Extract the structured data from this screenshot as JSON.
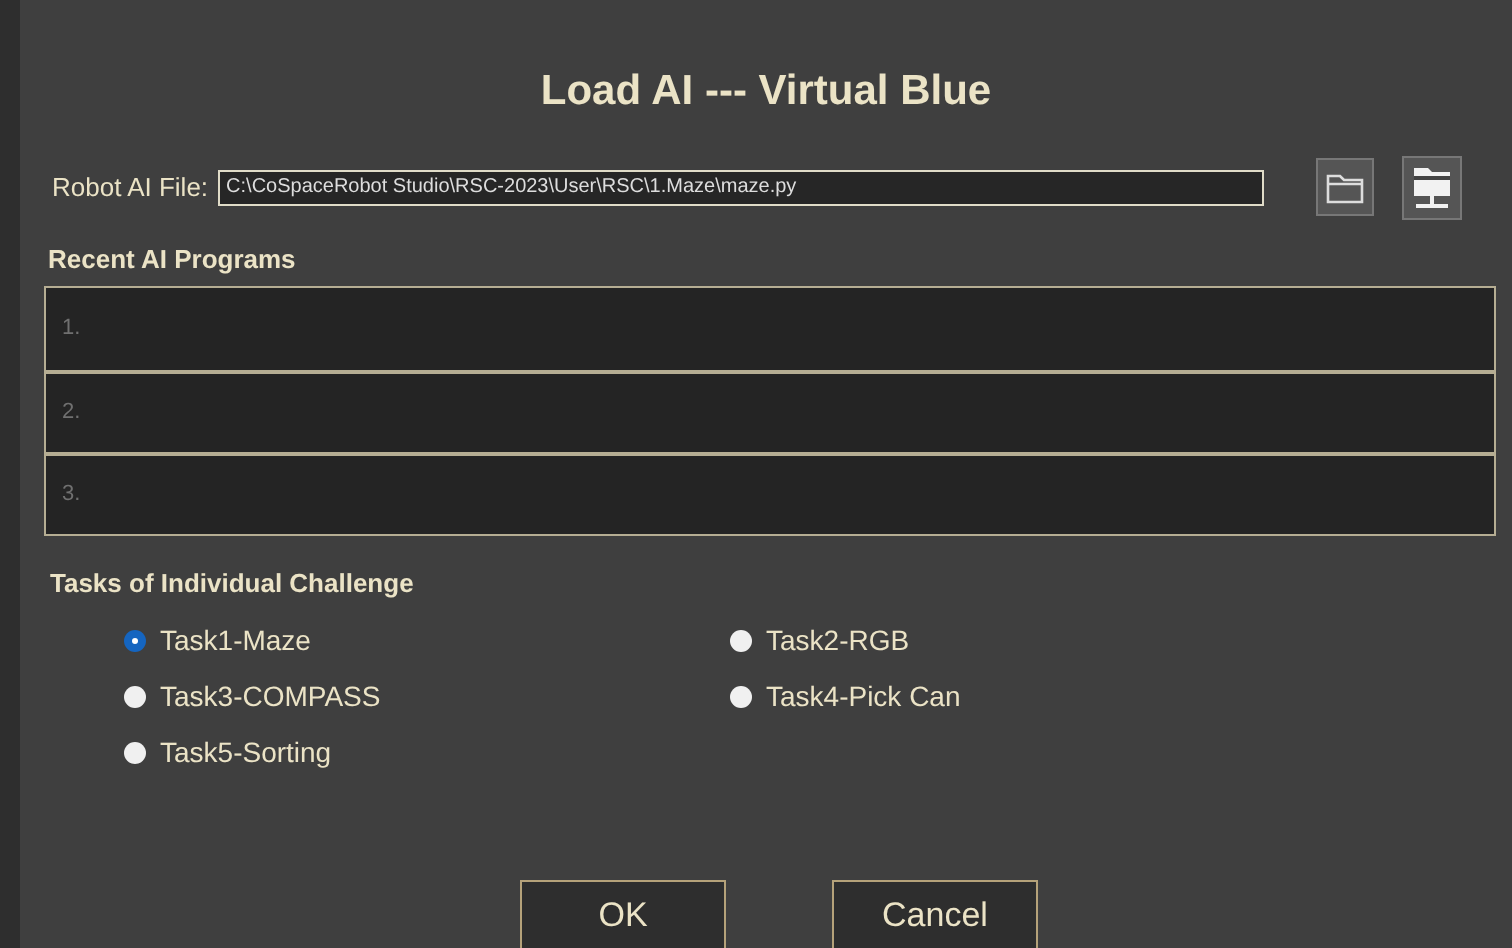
{
  "window": {
    "title": "Load AI --- Virtual Blue"
  },
  "file": {
    "label": "Robot AI File:",
    "value": "C:\\CoSpaceRobot Studio\\RSC-2023\\User\\RSC\\1.Maze\\maze.py"
  },
  "recent": {
    "title": "Recent AI Programs",
    "items": [
      "1.",
      "2.",
      "3."
    ]
  },
  "tasks": {
    "title": "Tasks of Individual Challenge",
    "options": [
      {
        "label": "Task1-Maze",
        "selected": true
      },
      {
        "label": "Task2-RGB",
        "selected": false
      },
      {
        "label": "Task3-COMPASS",
        "selected": false
      },
      {
        "label": "Task4-Pick Can",
        "selected": false
      },
      {
        "label": "Task5-Sorting",
        "selected": false
      }
    ]
  },
  "buttons": [
    "OK",
    "Cancel"
  ]
}
